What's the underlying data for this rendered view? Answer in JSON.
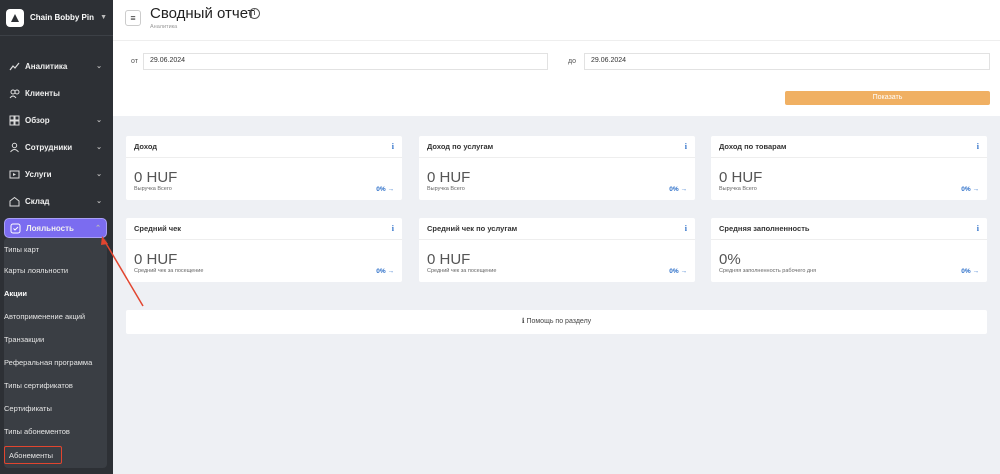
{
  "brand": {
    "name": "Chain Bobby Pin"
  },
  "nav": [
    {
      "label": "Аналитика",
      "icon": "analytics-icon",
      "chevron": true
    },
    {
      "label": "Клиенты",
      "icon": "clients-icon",
      "chevron": false
    },
    {
      "label": "Обзор",
      "icon": "overview-icon",
      "chevron": true
    },
    {
      "label": "Сотрудники",
      "icon": "employees-icon",
      "chevron": true
    },
    {
      "label": "Услуги",
      "icon": "services-icon",
      "chevron": true
    },
    {
      "label": "Склад",
      "icon": "warehouse-icon",
      "chevron": true
    },
    {
      "label": "Лояльность",
      "icon": "loyalty-icon",
      "chevron": true,
      "active": true
    }
  ],
  "submenu": [
    {
      "label": "Типы карт",
      "bold": false
    },
    {
      "label": "Карты лояльности",
      "bold": false
    },
    {
      "label": "Акции",
      "bold": true
    },
    {
      "label": "Автоприменение акций",
      "bold": false
    },
    {
      "label": "Транзакции",
      "bold": false
    },
    {
      "label": "Реферальная программа",
      "bold": false
    },
    {
      "label": "Типы сертификатов",
      "bold": false
    },
    {
      "label": "Сертификаты",
      "bold": false
    },
    {
      "label": "Типы абонементов",
      "bold": false
    },
    {
      "label": "Абонементы",
      "bold": false
    }
  ],
  "header": {
    "title": "Сводный отчет",
    "breadcrumb": "Аналитика",
    "menu_glyph": "≡",
    "info_glyph": "i"
  },
  "filters": {
    "from_label": "от",
    "from_value": "29.06.2024",
    "to_label": "до",
    "to_value": "29.06.2024",
    "show_button": "Показать"
  },
  "cards": [
    {
      "title": "Доход",
      "value": "0 HUF",
      "sub": "Выручка Всего",
      "pct": "0% →"
    },
    {
      "title": "Доход по услугам",
      "value": "0 HUF",
      "sub": "Выручка Всего",
      "pct": "0% →"
    },
    {
      "title": "Доход по товарам",
      "value": "0 HUF",
      "sub": "Выручка Всего",
      "pct": "0% →"
    },
    {
      "title": "Средний чек",
      "value": "0 HUF",
      "sub": "Средний чек за посещение",
      "pct": "0% →"
    },
    {
      "title": "Средний чек по услугам",
      "value": "0 HUF",
      "sub": "Средний чек за посещение",
      "pct": "0% →"
    },
    {
      "title": "Средняя заполненность",
      "value": "0%",
      "sub": "Средняя заполненность рабочего дня",
      "pct": "0% →"
    }
  ],
  "card_info_glyph": "i",
  "help": {
    "label": "ℹ Помощь по разделу"
  },
  "colors": {
    "sidebar": "#2d3035",
    "active": "#7b6cf0",
    "accent_blue": "#2c6fc9",
    "show_button": "#f0b063",
    "highlight": "#e2452f"
  }
}
